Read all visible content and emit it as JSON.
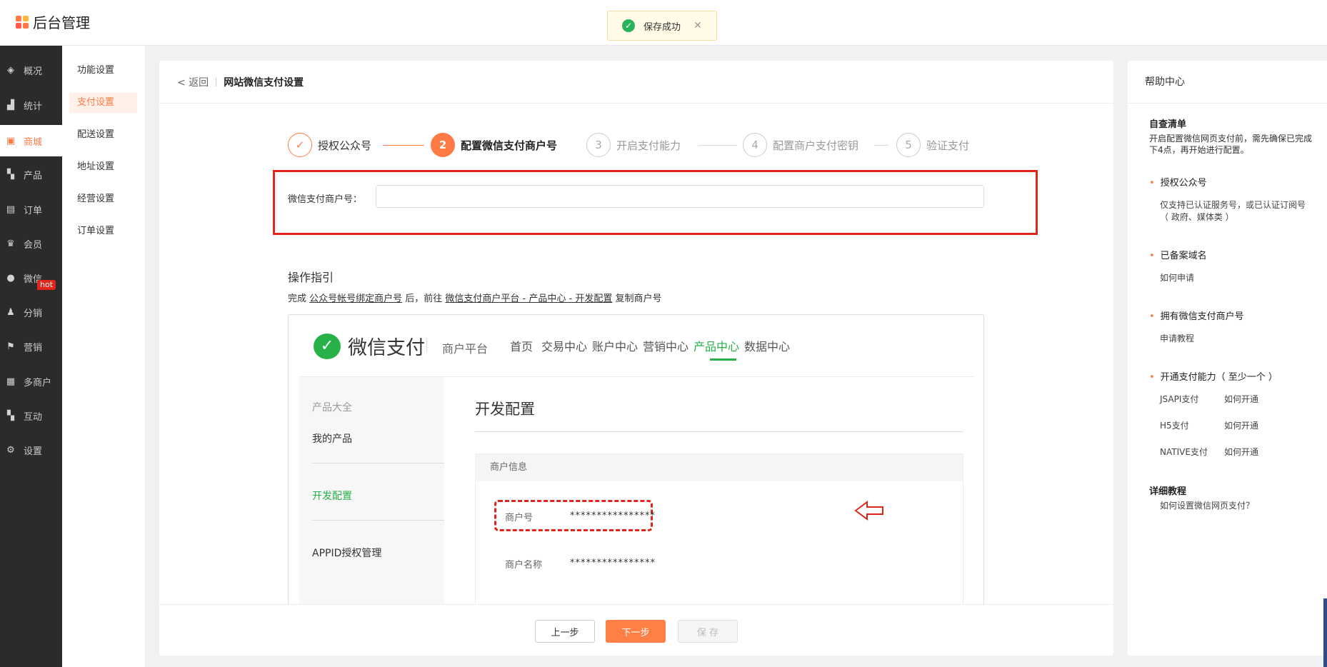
{
  "app": {
    "title": "后台管理"
  },
  "toast": {
    "message": "保存成功"
  },
  "sidebar": {
    "items": [
      {
        "label": "概况",
        "icon": "layers-icon"
      },
      {
        "label": "统计",
        "icon": "chart-icon"
      },
      {
        "label": "商城",
        "icon": "store-icon"
      },
      {
        "label": "产品",
        "icon": "grid-icon"
      },
      {
        "label": "订单",
        "icon": "order-icon"
      },
      {
        "label": "会员",
        "icon": "crown-icon"
      },
      {
        "label": "微信",
        "icon": "wechat-icon"
      },
      {
        "label": "分销",
        "icon": "users-icon"
      },
      {
        "label": "营销",
        "icon": "flag-icon"
      },
      {
        "label": "多商户",
        "icon": "merchant-icon"
      },
      {
        "label": "互动",
        "icon": "grid-icon"
      },
      {
        "label": "设置",
        "icon": "gear-icon"
      }
    ],
    "hot_badge": "hot"
  },
  "subnav": {
    "items": [
      "功能设置",
      "支付设置",
      "配送设置",
      "地址设置",
      "经营设置",
      "订单设置"
    ]
  },
  "header": {
    "back": "< 返回",
    "title": "网站微信支付设置"
  },
  "steps": [
    {
      "num": "✓",
      "label": "授权公众号"
    },
    {
      "num": "2",
      "label": "配置微信支付商户号"
    },
    {
      "num": "3",
      "label": "开启支付能力"
    },
    {
      "num": "4",
      "label": "配置商户支付密钥"
    },
    {
      "num": "5",
      "label": "验证支付"
    }
  ],
  "form": {
    "merchant_label": "微信支付商户号：",
    "merchant_value": ""
  },
  "guide": {
    "title": "操作指引",
    "t1": "完成 ",
    "link1": "公众号帐号绑定商户号",
    "t2": " 后，前往 ",
    "link2": "微信支付商户平台 - 产品中心 - 开发配置",
    "t3": " 复制商户号"
  },
  "preview": {
    "brand": "微信支付",
    "platform": "商户平台",
    "nav": [
      "首页",
      "交易中心",
      "账户中心",
      "营销中心",
      "产品中心",
      "数据中心"
    ],
    "left": [
      "产品大全",
      "我的产品",
      "开发配置",
      "APPID授权管理"
    ],
    "heading": "开发配置",
    "panel_title": "商户信息",
    "row1_label": "商户号",
    "row1_value": "****************",
    "row2_label": "商户名称",
    "row2_value": "****************"
  },
  "footer": {
    "prev": "上一步",
    "next": "下一步",
    "save": "保 存"
  },
  "help": {
    "title": "帮助中心",
    "checklist_title": "自查清单",
    "checklist_line1": "开启配置微信网页支付前，需先确保已完成",
    "checklist_line2": "下4点，再开始进行配置。",
    "b1": "授权公众号",
    "b1_line1": "仅支持已认证服务号，或已认证订阅号",
    "b1_line2": "（ 政府、媒体类 ）",
    "b2": "已备案域名",
    "b2_sub": "如何申请",
    "b3": "拥有微信支付商户号",
    "b3_sub": "申请教程",
    "b4": "开通支付能力（ 至少一个 ）",
    "pay": [
      {
        "name": "JSAPI支付",
        "link": "如何开通"
      },
      {
        "name": "H5支付",
        "link": "如何开通"
      },
      {
        "name": "NATIVE支付",
        "link": "如何开通"
      }
    ],
    "tutorial_title": "详细教程",
    "tutorial_link": "如何设置微信网页支付？"
  },
  "colors": {
    "accent": "#ff7a45",
    "wechat": "#27b148",
    "alert": "#e1251b"
  }
}
